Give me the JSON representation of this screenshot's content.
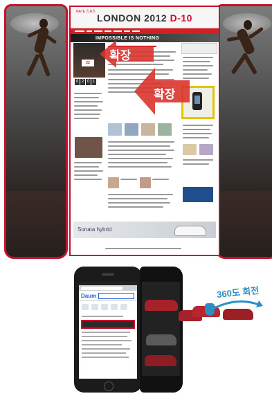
{
  "figure": {
    "top_callout": "확장",
    "side_callout": "확장",
    "rotate_callout": "360도 회전"
  },
  "portal_page": {
    "brand": "NATE 스포츠",
    "title_main": "LONDON 2012",
    "title_dday": "D-10",
    "banner": "IMPOSSIBLE IS NOTHING",
    "hero_bib": "22",
    "counter_digits": [
      "0",
      "2",
      "0",
      "1"
    ],
    "ad_label": "Sonata hybrid",
    "nav_items": [
      "",
      "",
      "",
      "",
      "",
      "",
      "",
      ""
    ]
  },
  "mobile": {
    "logo": "Daum"
  },
  "colors": {
    "frame_red": "#c8102e",
    "ad_highlight": "#e3c400",
    "callout_blue": "#2a8fc5"
  }
}
